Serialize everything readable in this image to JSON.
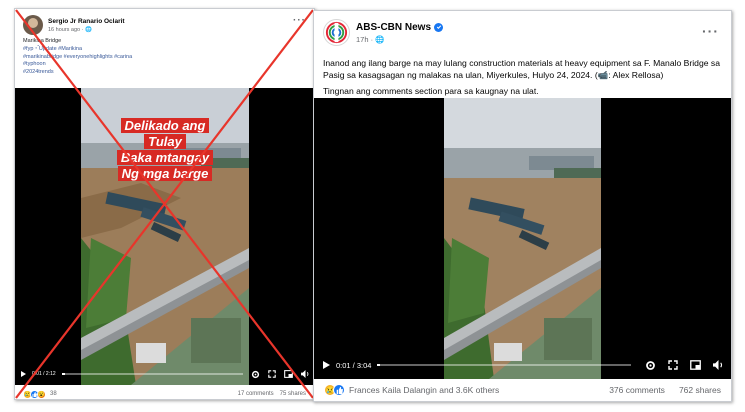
{
  "left_post": {
    "author": "Sergio Jr Ranario Oclarit",
    "time": "16 hours ago · ",
    "caption_title": "Marikina Bridge",
    "hashtags": [
      "#fyp・゚Update #Marikina",
      "#marikinabridge #everyonehighlights #carina",
      "#typhoon",
      "#2024trends"
    ],
    "overlay_lines": [
      "Delikado ang",
      "Tulay",
      "Baka mtangay",
      "Ng mga barge"
    ],
    "video_time": "0:01 / 2:12",
    "progress": 0.02,
    "reaction_count": "38",
    "comments": "17 comments",
    "shares": "75 shares"
  },
  "right_post": {
    "page_name": "ABS-CBN News",
    "time": "17h · ",
    "caption_p1": "Inanod ang ilang barge na may lulang construction materials at heavy equipment sa F. Manalo Bridge sa Pasig sa kasagsagan ng malakas na ulan, Miyerkules, Hulyo 24, 2024. (📹: Alex Rellosa)",
    "caption_p2": "Tingnan ang comments section para sa kaugnay na ulat.",
    "video_time": "0:01 / 3:04",
    "progress": 0.01,
    "reactions_text": "Frances Kaila Dalangin and 3.6K others",
    "comments": "376 comments",
    "shares": "762 shares"
  },
  "colors": {
    "fake_x": "#e8352b",
    "overlay_red": "#d72a24",
    "link_blue": "#385898",
    "facebook_blue": "#1877f2"
  },
  "icons": [
    "more-options-icon",
    "globe-icon",
    "verified-badge-icon",
    "play-icon",
    "settings-icon",
    "fullscreen-icon",
    "picture-in-picture-icon",
    "volume-icon",
    "like-reaction-icon",
    "sad-reaction-icon"
  ]
}
